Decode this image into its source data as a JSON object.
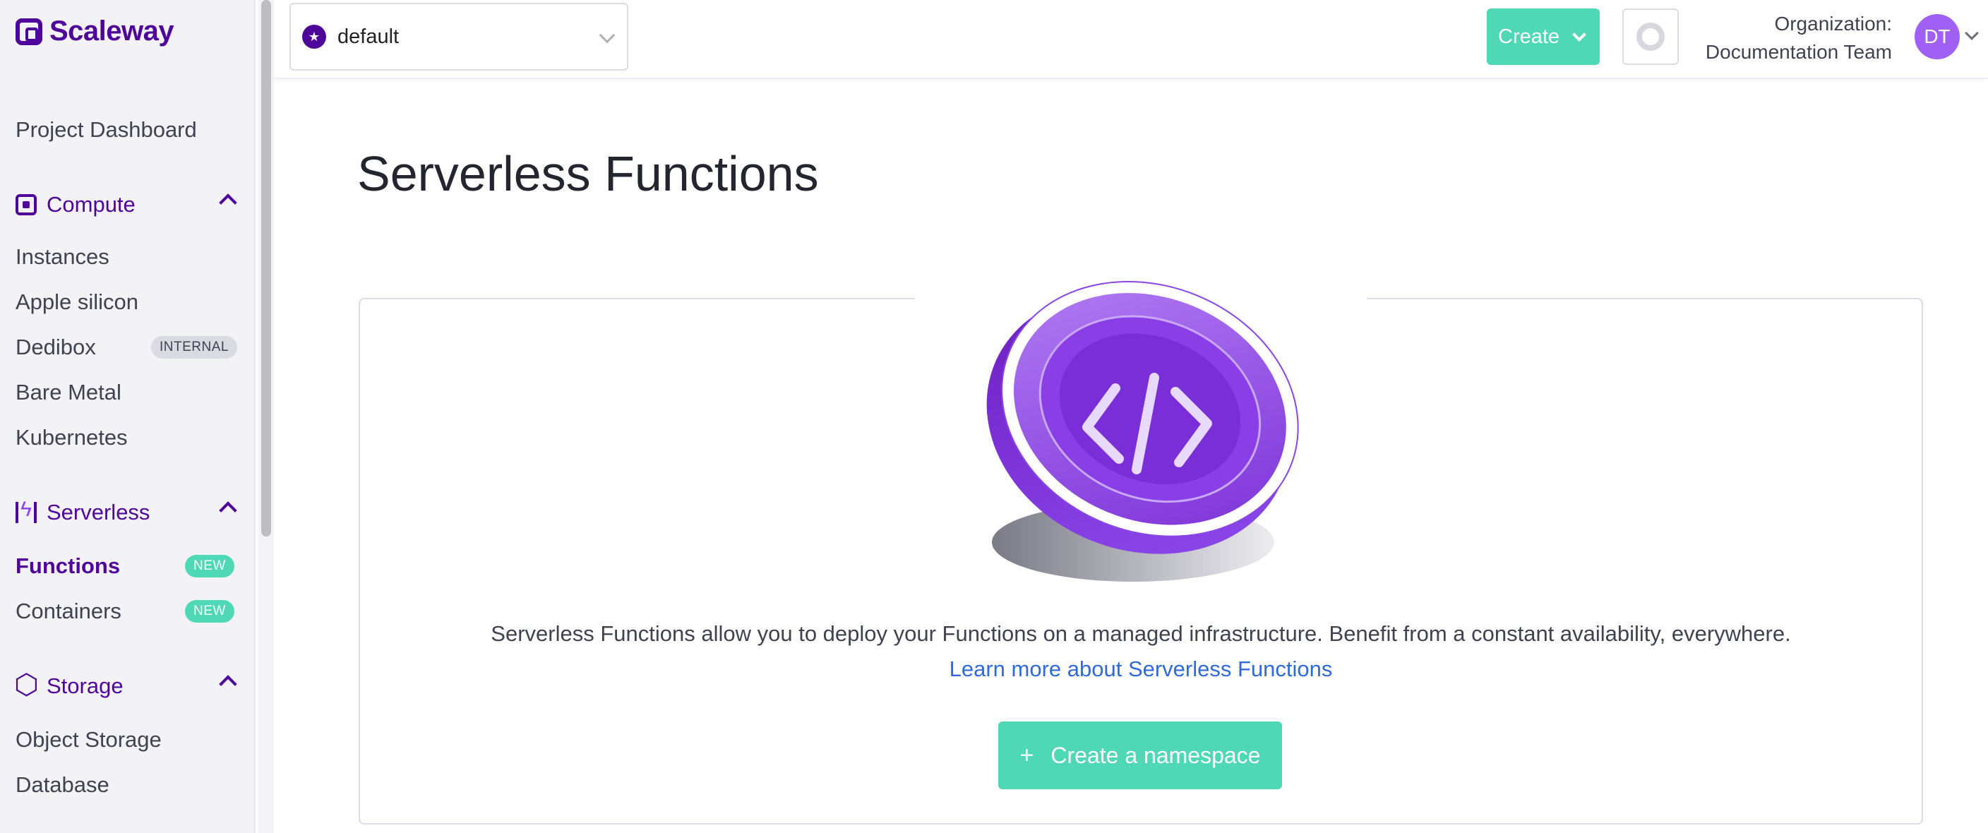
{
  "brand": {
    "name": "Scaleway"
  },
  "sidebar": {
    "dashboard": "Project Dashboard",
    "groups": [
      {
        "label": "Compute",
        "items": [
          "Instances",
          "Apple silicon",
          "Dedibox",
          "Bare Metal",
          "Kubernetes"
        ]
      },
      {
        "label": "Serverless",
        "items": [
          "Functions",
          "Containers"
        ]
      },
      {
        "label": "Storage",
        "items": [
          "Object Storage",
          "Database"
        ]
      }
    ],
    "badges": {
      "internal": "INTERNAL",
      "new": "NEW"
    },
    "active_item": "Functions"
  },
  "topbar": {
    "project": "default",
    "create_label": "Create",
    "org_label": "Organization:",
    "org_name": "Documentation Team",
    "avatar_initials": "DT"
  },
  "main": {
    "title": "Serverless Functions",
    "description": "Serverless Functions allow you to deploy your Functions on a managed infrastructure. Benefit from a constant availability, everywhere.",
    "learn_more": "Learn more about Serverless Functions",
    "cta_label": "Create a namespace"
  },
  "colors": {
    "brand": "#4f0599",
    "accent_green": "#4fd8b5",
    "link": "#2f6ad9",
    "avatar": "#a060f6"
  }
}
